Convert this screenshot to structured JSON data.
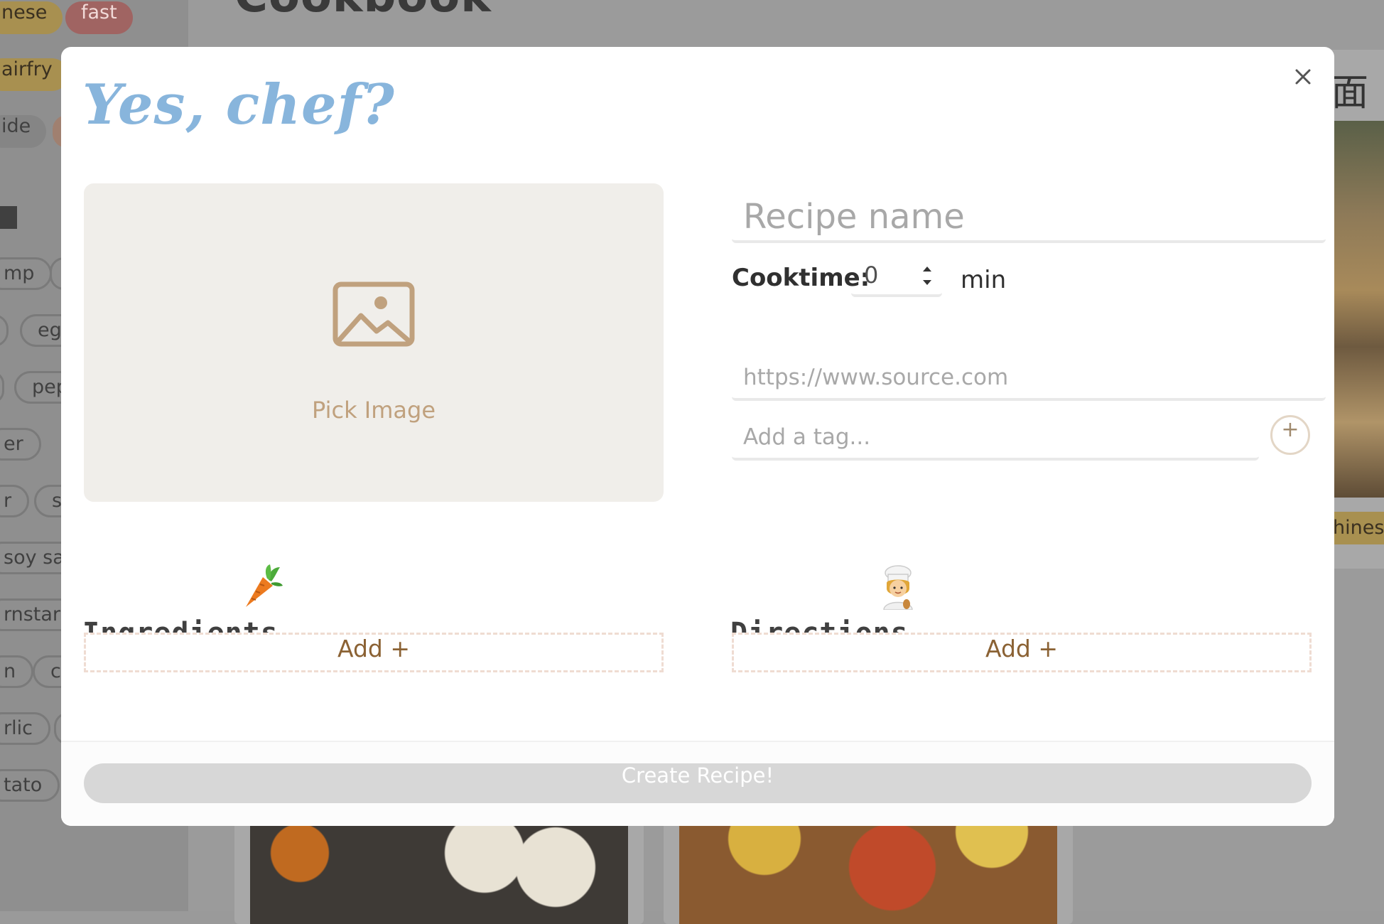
{
  "background": {
    "page_title": "Cookbook",
    "tags_top": [
      "nese",
      "fast"
    ],
    "tags_side": [
      "airfry",
      "ide",
      "mp",
      "egg",
      "pep",
      "er",
      "r",
      "sa",
      "soy sau",
      "rnstarc",
      "n",
      "ce",
      "rlic",
      "tato"
    ],
    "card_tag": "hinese",
    "card_title": "面包"
  },
  "modal": {
    "title": "Yes, chef?",
    "close_icon": "close-icon",
    "image_picker": {
      "icon": "image-icon",
      "label": "Pick Image"
    },
    "recipe_name": {
      "placeholder": "Recipe name",
      "value": ""
    },
    "cooktime": {
      "label": "Cooktime:",
      "value": "0",
      "unit": "min"
    },
    "source": {
      "placeholder": "https://www.source.com",
      "value": ""
    },
    "tag": {
      "placeholder": "Add a tag...",
      "value": "",
      "add_label": "+"
    },
    "ingredients": {
      "title": "Ingredients",
      "emoji": "carrot-icon",
      "add_label": "Add +"
    },
    "directions": {
      "title": "Directions",
      "emoji": "chef-icon",
      "add_label": "Add +"
    },
    "submit_label": "Create Recipe!"
  },
  "colors": {
    "title_blue": "#88b5dc",
    "accent_tan": "#c0a17e",
    "add_brown": "#8b6234",
    "disabled_button": "#d7d7d7"
  }
}
